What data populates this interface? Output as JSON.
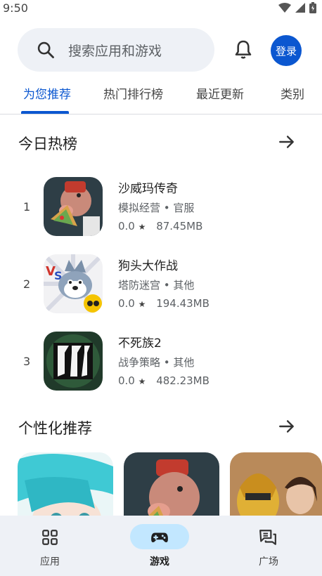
{
  "status_bar": {
    "time": "9:50"
  },
  "search": {
    "placeholder": "搜索应用和游戏"
  },
  "header": {
    "login_label": "登录"
  },
  "tabs": [
    {
      "label": "为您推荐"
    },
    {
      "label": "热门排行榜"
    },
    {
      "label": "最近更新"
    },
    {
      "label": "类别"
    }
  ],
  "top_today": {
    "title": "今日热榜",
    "items": [
      {
        "rank": "1",
        "name": "沙威玛传奇",
        "genre": "模拟经营",
        "edition": "官服",
        "rating": "0.0",
        "size": "87.45MB"
      },
      {
        "rank": "2",
        "name": "狗头大作战",
        "genre": "塔防迷宫",
        "edition": "其他",
        "rating": "0.0",
        "size": "194.43MB"
      },
      {
        "rank": "3",
        "name": "不死族2",
        "genre": "战争策略",
        "edition": "其他",
        "rating": "0.0",
        "size": "482.23MB"
      }
    ]
  },
  "personal": {
    "title": "个性化推荐"
  },
  "bottom_nav": [
    {
      "label": "应用",
      "icon": "grid-icon"
    },
    {
      "label": "游戏",
      "icon": "gamepad-icon"
    },
    {
      "label": "广场",
      "icon": "chat-icon"
    }
  ],
  "colors": {
    "accent": "#0b57d0",
    "nav_active": "#c2e7ff",
    "surface": "#eef1f6"
  }
}
